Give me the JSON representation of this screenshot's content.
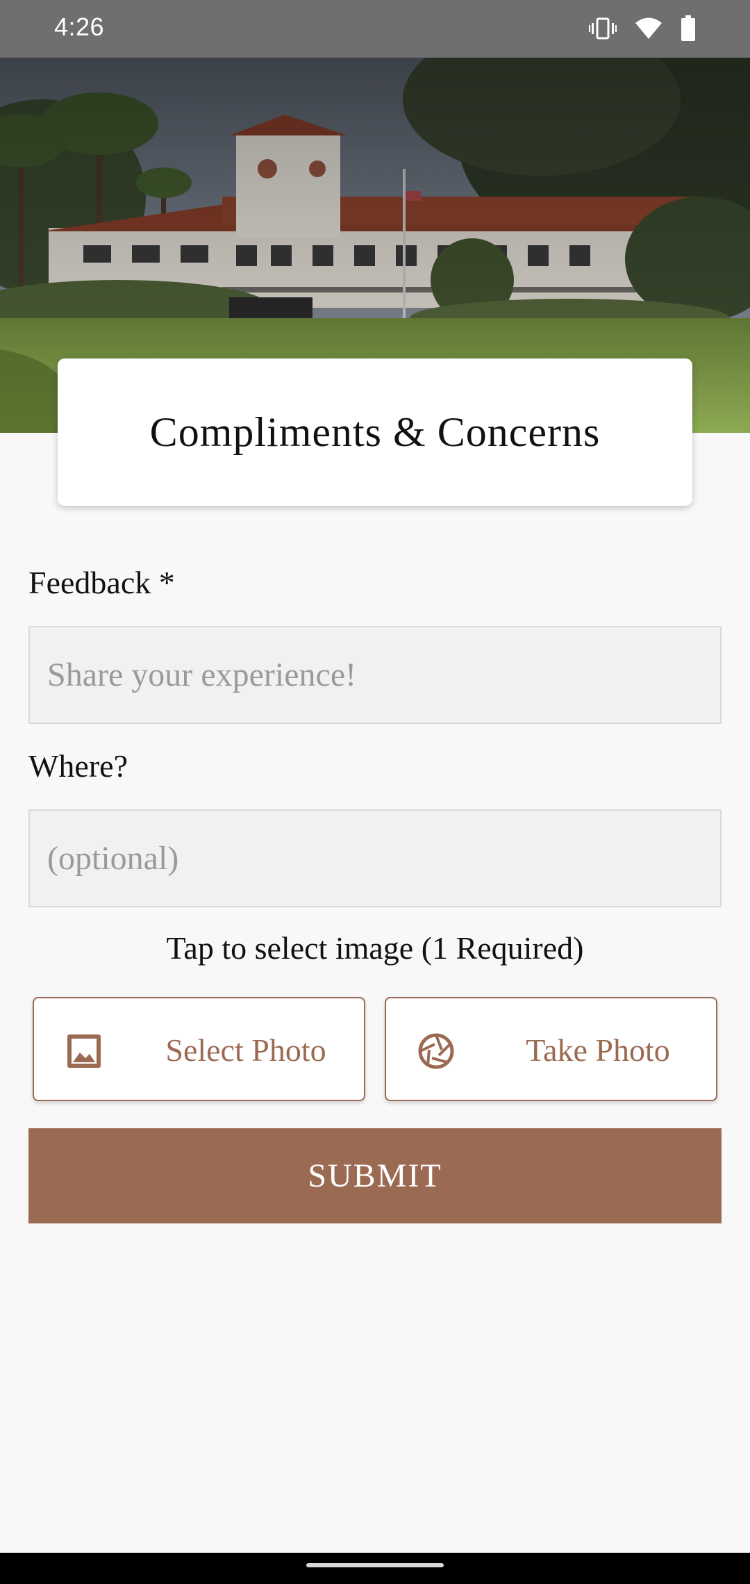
{
  "status_bar": {
    "time": "4:26",
    "icons": [
      "vibrate-icon",
      "wifi-icon",
      "battery-icon"
    ]
  },
  "hero": {
    "image": "golf-clubhouse-photo"
  },
  "header": {
    "title": "Compliments & Concerns"
  },
  "form": {
    "feedback_label": "Feedback *",
    "feedback_placeholder": "Share your experience!",
    "feedback_value": "",
    "where_label": "Where?",
    "where_placeholder": "(optional)",
    "where_value": "",
    "image_hint": "Tap to select image (1 Required)",
    "select_photo_label": "Select Photo",
    "take_photo_label": "Take Photo",
    "submit_label": "SUBMIT"
  },
  "colors": {
    "accent": "#9b6a52",
    "status_bar": "#6f6e70",
    "background": "#f9f8f9",
    "field_background": "#f3f1f0"
  }
}
